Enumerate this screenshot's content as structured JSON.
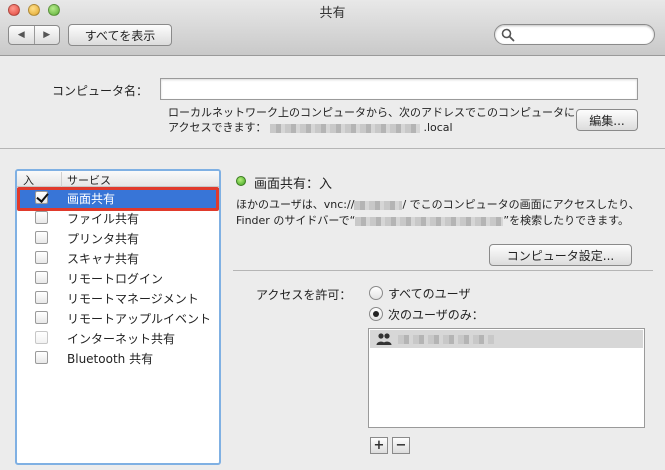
{
  "window": {
    "title": "共有"
  },
  "toolbar": {
    "back_glyph": "◀",
    "forward_glyph": "▶",
    "show_all_label": "すべてを表示",
    "search_value": "",
    "icons": {
      "search": "search-icon"
    }
  },
  "computer_name": {
    "label": "コンピュータ名：",
    "value": "",
    "desc_line1": "ローカルネットワーク上のコンピュータから、次のアドレスでこのコンピュータに",
    "desc_line2_prefix": "アクセスできます：",
    "desc_line2_suffix": ".local",
    "edit_label": "編集..."
  },
  "services": {
    "header_on": "入",
    "header_service": "サービス",
    "items": [
      {
        "label": "画面共有",
        "checked": true,
        "selected": true
      },
      {
        "label": "ファイル共有",
        "checked": false
      },
      {
        "label": "プリンタ共有",
        "checked": false
      },
      {
        "label": "スキャナ共有",
        "checked": false
      },
      {
        "label": "リモートログイン",
        "checked": false
      },
      {
        "label": "リモートマネージメント",
        "checked": false
      },
      {
        "label": "リモートアップルイベント",
        "checked": false
      },
      {
        "label": "インターネット共有",
        "checked": false,
        "disabled": true
      },
      {
        "label": "Bluetooth 共有",
        "checked": false
      }
    ]
  },
  "detail": {
    "status": "画面共有：入",
    "status_color": "#3ca020",
    "desc1_prefix": "ほかのユーザは、vnc://",
    "desc1_suffix": "/ でこのコンピュータの画面にアクセスしたり、",
    "desc2_prefix": "Finder のサイドバーで“",
    "desc2_suffix": "”を検索したりできます。",
    "computer_settings_label": "コンピュータ設定...",
    "access_label": "アクセスを許可：",
    "option_all": "すべてのユーザ",
    "option_only": "次のユーザのみ：",
    "selected_option": "only",
    "user_icon": "users-icon",
    "add_label": "+",
    "remove_label": "−"
  },
  "colors": {
    "selection": "#3875d7",
    "focus_ring": "#7fb0e3",
    "highlight_box": "#e03a2c"
  }
}
